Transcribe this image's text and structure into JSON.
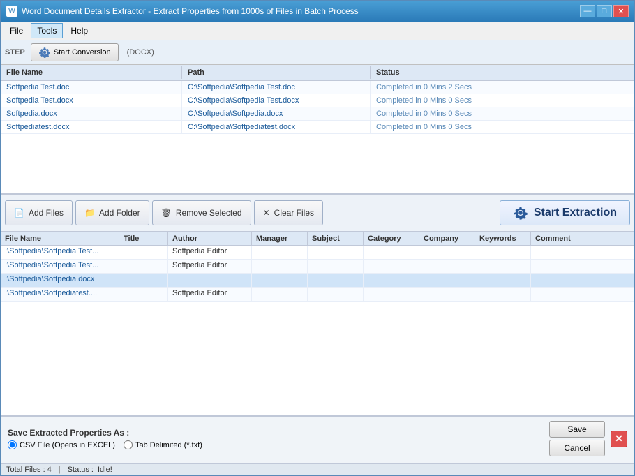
{
  "window": {
    "title": "Word Document Details Extractor - Extract Properties from 1000s of Files in Batch Process",
    "icon": "W"
  },
  "title_controls": {
    "minimize": "—",
    "maximize": "□",
    "close": "✕"
  },
  "menu": {
    "items": [
      "File",
      "Tools",
      "Help"
    ]
  },
  "toolbar": {
    "step_label": "STEP",
    "start_conversion": "Start Conversion",
    "format_label": "(DOCX)"
  },
  "top_table": {
    "headers": [
      "File Name",
      "Path",
      "Status"
    ],
    "rows": [
      {
        "filename": "Softpedia Test.doc",
        "path": "C:\\Softpedia\\Softpedia Test.doc",
        "status": "Completed in 0 Mins 2 Secs"
      },
      {
        "filename": "Softpedia Test.docx",
        "path": "C:\\Softpedia\\Softpedia Test.docx",
        "status": "Completed in 0 Mins 0 Secs"
      },
      {
        "filename": "Softpedia.docx",
        "path": "C:\\Softpedia\\Softpedia.docx",
        "status": "Completed in 0 Mins 0 Secs"
      },
      {
        "filename": "Softpediatest.docx",
        "path": "C:\\Softpedia\\Softpediatest.docx",
        "status": "Completed in 0 Mins 0 Secs"
      }
    ]
  },
  "buttons": {
    "add_files": "Add Files",
    "add_folder": "Add Folder",
    "remove_selected": "Remove Selected",
    "clear_files": "Clear Files",
    "start_extraction": "Start Extraction"
  },
  "bottom_table": {
    "headers": [
      "File Name",
      "Title",
      "Author",
      "Manager",
      "Subject",
      "Category",
      "Company",
      "Keywords",
      "Comment"
    ],
    "rows": [
      {
        "filename": ":\\Softpedia\\Softpedia Test...",
        "title": "",
        "author": "Softpedia Editor",
        "manager": "",
        "subject": "",
        "category": "",
        "company": "",
        "keywords": "",
        "comment": "",
        "highlighted": false
      },
      {
        "filename": ":\\Softpedia\\Softpedia Test...",
        "title": "",
        "author": "Softpedia Editor",
        "manager": "",
        "subject": "",
        "category": "",
        "company": "",
        "keywords": "",
        "comment": "",
        "highlighted": false
      },
      {
        "filename": ":\\Softpedia\\Softpedia.docx",
        "title": "",
        "author": "",
        "manager": "",
        "subject": "",
        "category": "",
        "company": "",
        "keywords": "",
        "comment": "",
        "highlighted": true
      },
      {
        "filename": ":\\Softpedia\\Softpediatest....",
        "title": "",
        "author": "Softpedia Editor",
        "manager": "",
        "subject": "",
        "category": "",
        "company": "",
        "keywords": "",
        "comment": "",
        "highlighted": false
      }
    ]
  },
  "footer": {
    "save_label": "Save Extracted Properties As :",
    "options": [
      {
        "id": "csv",
        "label": "CSV File (Opens in EXCEL)",
        "checked": true
      },
      {
        "id": "tab",
        "label": "Tab Delimited (*.txt)",
        "checked": false
      }
    ],
    "save_btn": "Save",
    "cancel_btn": "Cancel"
  },
  "status_bar": {
    "total_files_label": "Total Files : 4",
    "status_label": "Status :",
    "status_value": "Idle!"
  },
  "colors": {
    "accent_blue": "#2a7ab8",
    "link_blue": "#1a5a9a",
    "status_blue": "#5a8ab8",
    "header_bg": "#dde8f5",
    "row_odd": "#f8fbff",
    "highlight_row": "#d0e4f8"
  }
}
